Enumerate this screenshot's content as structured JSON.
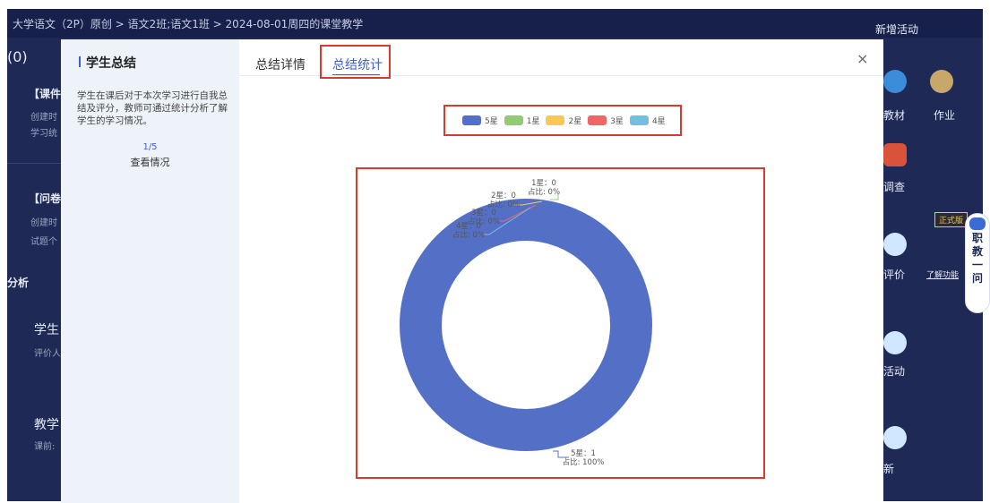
{
  "app": {
    "breadcrumb": "大学语文（2P）原创 > 语文2班;语文1班 > 2024-08-01周四的课堂教学",
    "new_activity": "新增活动",
    "count": "(0)"
  },
  "background_left": {
    "courseware_label": "【课件",
    "created_1": "创建时",
    "learn_stats": "学习统",
    "survey_label": "【问卷",
    "created_2": "创建时",
    "questions": "试题个",
    "analysis": "分析",
    "student_label": "学生",
    "rater_label": "评价人",
    "teaching_label": "教学",
    "before_class": "课前:"
  },
  "background_right": {
    "textbook": "教材",
    "homework": "作业",
    "survey": "调查",
    "evaluation": "评价",
    "learn_feature": "了解功能",
    "activity": "活动",
    "refresh": "新",
    "official_tag": "正式版",
    "ai_chars": [
      "职",
      "教",
      "一",
      "问"
    ]
  },
  "modal": {
    "left_title": "学生总结",
    "left_desc": "学生在课后对于本次学习进行自我总结及评分，教师可通过统计分析了解学生的学习情况。",
    "page_indicator": "1/5",
    "view_status": "查看情况",
    "tabs": [
      {
        "label": "总结详情",
        "active": false
      },
      {
        "label": "总结统计",
        "active": true
      }
    ],
    "close_symbol": "×"
  },
  "chart_data": {
    "type": "pie",
    "style": "donut",
    "legend_position": "top-center",
    "series": [
      {
        "name": "5星",
        "value": 1,
        "share": "100%",
        "color": "#5470c6"
      },
      {
        "name": "1星",
        "value": 0,
        "share": "0%",
        "color": "#91cc75"
      },
      {
        "name": "2星",
        "value": 0,
        "share": "0%",
        "color": "#fac858"
      },
      {
        "name": "3星",
        "value": 0,
        "share": "0%",
        "color": "#ee6666"
      },
      {
        "name": "4星",
        "value": 0,
        "share": "0%",
        "color": "#73c0de"
      }
    ],
    "share_prefix": "占比: "
  }
}
